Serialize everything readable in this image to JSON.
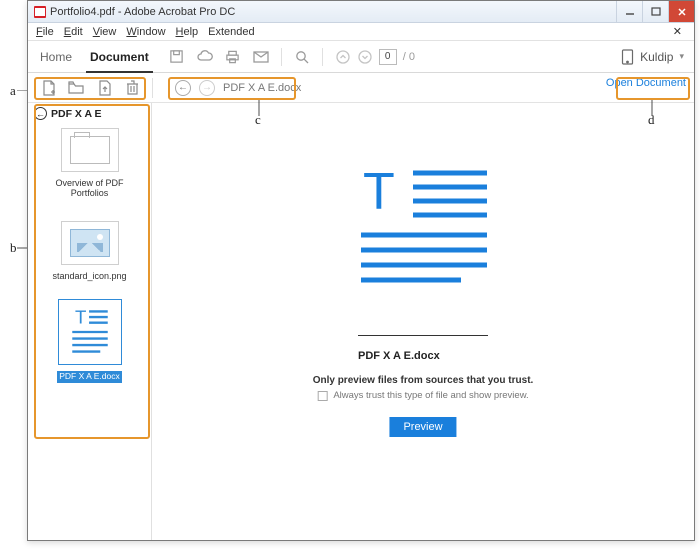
{
  "window": {
    "title": "Portfolio4.pdf - Adobe Acrobat Pro DC"
  },
  "menus": {
    "file": "File",
    "edit": "Edit",
    "view": "View",
    "window": "Window",
    "help": "Help",
    "extended": "Extended"
  },
  "tabs": {
    "home": "Home",
    "document": "Document"
  },
  "page": {
    "current": "0",
    "total": "0"
  },
  "user": {
    "name": "Kuldip"
  },
  "breadcrumb": {
    "file": "PDF X A E.docx"
  },
  "open_doc": "Open Document",
  "sidebar": {
    "title": "PDF X A E",
    "items": [
      {
        "label": "Overview of PDF Portfolios"
      },
      {
        "label": "standard_icon.png"
      },
      {
        "label": "PDF X A E.docx"
      }
    ]
  },
  "main": {
    "filename": "PDF X A E.docx",
    "trust_heading": "Only preview files from sources that you trust.",
    "trust_checkbox": "Always trust this type of file and show preview.",
    "preview_btn": "Preview"
  },
  "annotations": {
    "a": "a",
    "b": "b",
    "c": "c",
    "d": "d"
  },
  "icons": {
    "add": "add-file-icon",
    "open": "folder-open-icon",
    "extract": "extract-icon",
    "trash": "trash-icon",
    "save": "save-icon",
    "cloud": "cloud-icon",
    "print": "print-icon",
    "mail": "mail-icon",
    "search": "search-icon",
    "up": "page-up-icon",
    "down": "page-down-icon",
    "tablet": "tablet-icon"
  }
}
